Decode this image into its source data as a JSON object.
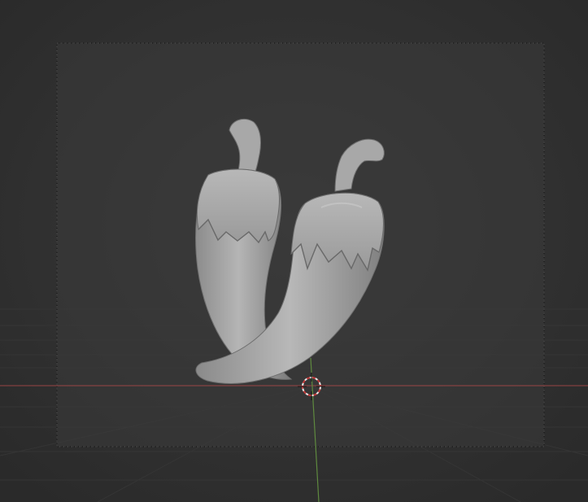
{
  "viewport": {
    "background_color": "#2a2a2a",
    "camera_frame_fill": "#393939",
    "x_axis_color": "#b34a4a",
    "y_axis_color": "#5f8a3f",
    "model_color": "#a5a5a5",
    "cursor_colors": [
      "#e8e8e8",
      "#c43c3c"
    ]
  },
  "scene": {
    "objects": [
      {
        "name": "pepper-left",
        "icon": "chili-pepper"
      },
      {
        "name": "pepper-right",
        "icon": "chili-pepper"
      }
    ],
    "cursor_icon": "3d-cursor-icon"
  }
}
